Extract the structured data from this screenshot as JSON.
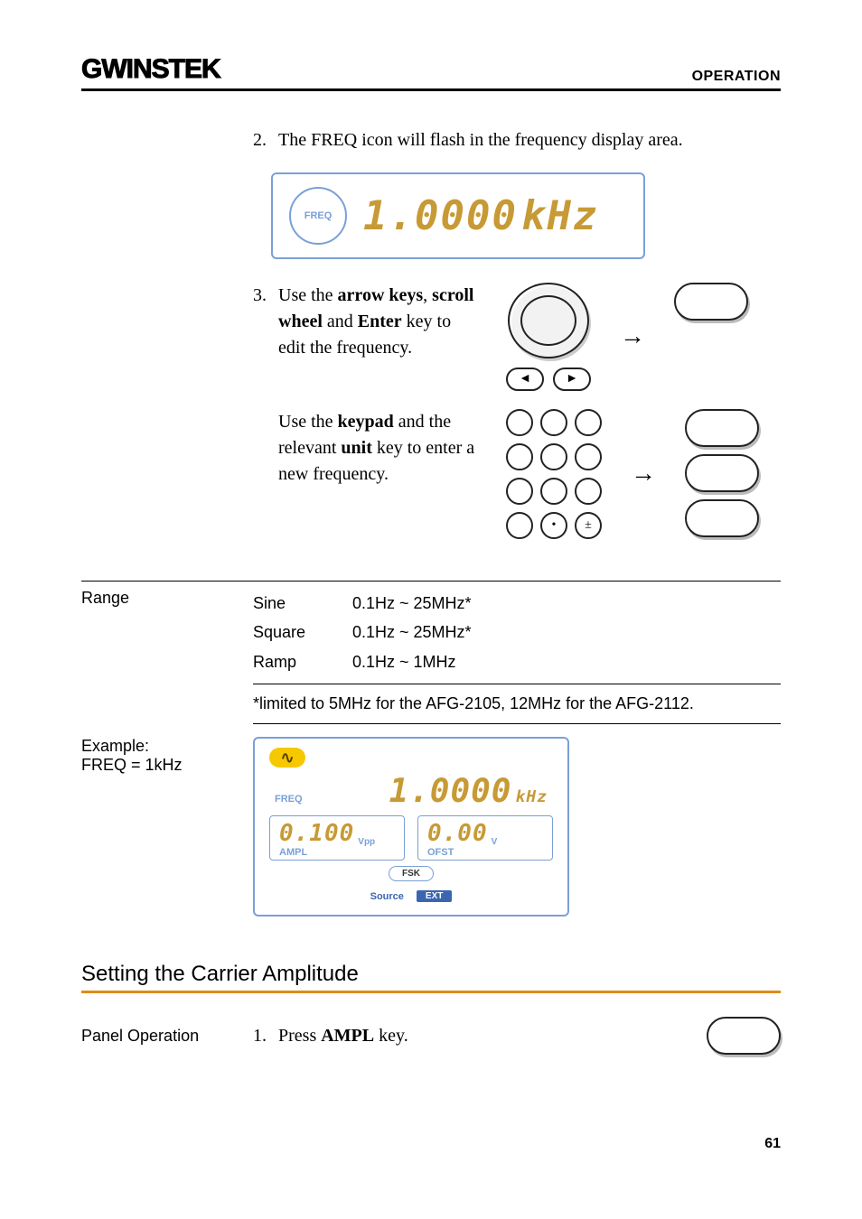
{
  "header": {
    "brand": "GWINSTEK",
    "section": "OPERATION"
  },
  "step2": {
    "num": "2.",
    "text_a": "The FREQ icon will flash in the frequency display area.",
    "panel_label": "FREQ",
    "panel_value": "1.0000",
    "panel_unit": "kHz"
  },
  "step3": {
    "num": "3.",
    "text_a_pre": "Use the ",
    "bold_arrow": "arrow keys",
    "sep1": ", ",
    "bold_scroll": "scroll wheel",
    "mid": " and ",
    "bold_enter": "Enter",
    "text_a_post": " key to edit the frequency.",
    "text_b_pre": "Use the ",
    "bold_keypad": "keypad",
    "mid2": " and the relevant ",
    "bold_unit": "unit",
    "text_b_post": " key to enter a new frequency."
  },
  "range": {
    "label": "Range",
    "rows": [
      {
        "name": "Sine",
        "val": "0.1Hz ~ 25MHz*"
      },
      {
        "name": "Square",
        "val": "0.1Hz ~ 25MHz*"
      },
      {
        "name": "Ramp",
        "val": "0.1Hz ~ 1MHz"
      }
    ],
    "note": "*limited to 5MHz for the AFG-2105, 12MHz for the AFG-2112."
  },
  "example": {
    "label_a": "Example:",
    "label_b": "FREQ = 1kHz",
    "screen": {
      "freq_label": "FREQ",
      "freq_val": "1.0000",
      "freq_unit": "kHz",
      "ampl_label": "AMPL",
      "ampl_val": "0.100",
      "ampl_unit": "Vpp",
      "ofst_label": "OFST",
      "ofst_val": "0.00",
      "ofst_unit": "V",
      "mode": "FSK",
      "source_label": "Source",
      "source_val": "EXT"
    }
  },
  "carrier_section": {
    "heading": "Setting the Carrier Amplitude",
    "panel_op": "Panel Operation",
    "step1_num": "1.",
    "step1_pre": "Press ",
    "step1_bold": "AMPL",
    "step1_post": " key."
  },
  "arrows": {
    "right": "→"
  },
  "page_number": "61"
}
